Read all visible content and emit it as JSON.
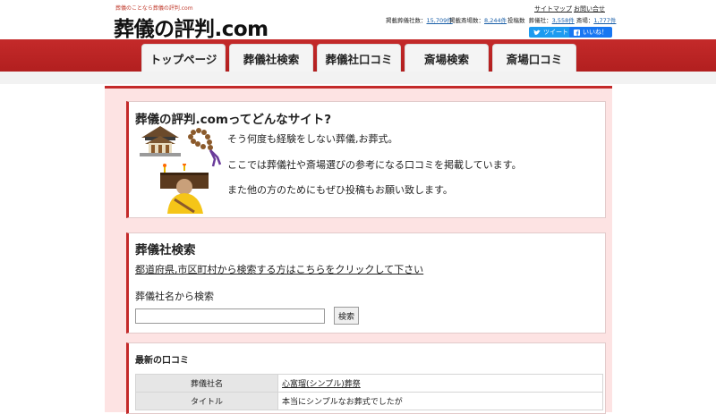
{
  "header": {
    "tagline": "葬儀のことなら葬儀の評判.com",
    "logo": "葬儀の評判.com",
    "links": [
      "サイトマップ",
      "お問い合せ"
    ],
    "stats": {
      "funeral_homes_label": "掲載葬儀社数：",
      "funeral_homes_value": "15,709件",
      "halls_label": "掲載斎場数：",
      "halls_value": "8,244件",
      "posts_label": "投稿数",
      "posts_funeral_label": "葬儀社：",
      "posts_funeral_value": "3,558件",
      "posts_hall_label": "斎場：",
      "posts_hall_value": "1,777件"
    },
    "social": {
      "tweet": "ツイート",
      "like": "いいね！"
    }
  },
  "nav": {
    "tabs": [
      "トップページ",
      "葬儀社検索",
      "葬儀社口コミ",
      "斎場検索",
      "斎場口コミ"
    ]
  },
  "intro": {
    "title": "葬儀の評判.comってどんなサイト?",
    "lines": [
      "そう何度も経験をしない葬儀,お葬式。",
      "ここでは葬儀社や斎場選びの参考になる口コミを掲載しています。",
      "また他の方のためにもぜひ投稿もお願い致します。"
    ]
  },
  "funeral_search": {
    "title": "葬儀社検索",
    "area_link": "都道府県,市区町村から検索する方はこちらをクリックして下さい",
    "name_label": "葬儀社名から検索",
    "input_value": "",
    "button": "検索"
  },
  "latest_reviews": {
    "title": "最新の口コミ",
    "rows": [
      {
        "label": "葬儀社名",
        "value": "心富瑠(シンプル)葬祭"
      },
      {
        "label": "タイトル",
        "value": "本当にシンプルなお葬式でしたが"
      }
    ]
  },
  "colors": {
    "brand_red": "#c42a2a",
    "page_pink": "#fde3e3",
    "twitter_blue": "#1d9bf0",
    "facebook_blue": "#1877f2"
  },
  "icons": [
    "temple-icon",
    "prayer-beads-icon",
    "monk-icon",
    "twitter-bird-icon",
    "facebook-icon"
  ]
}
